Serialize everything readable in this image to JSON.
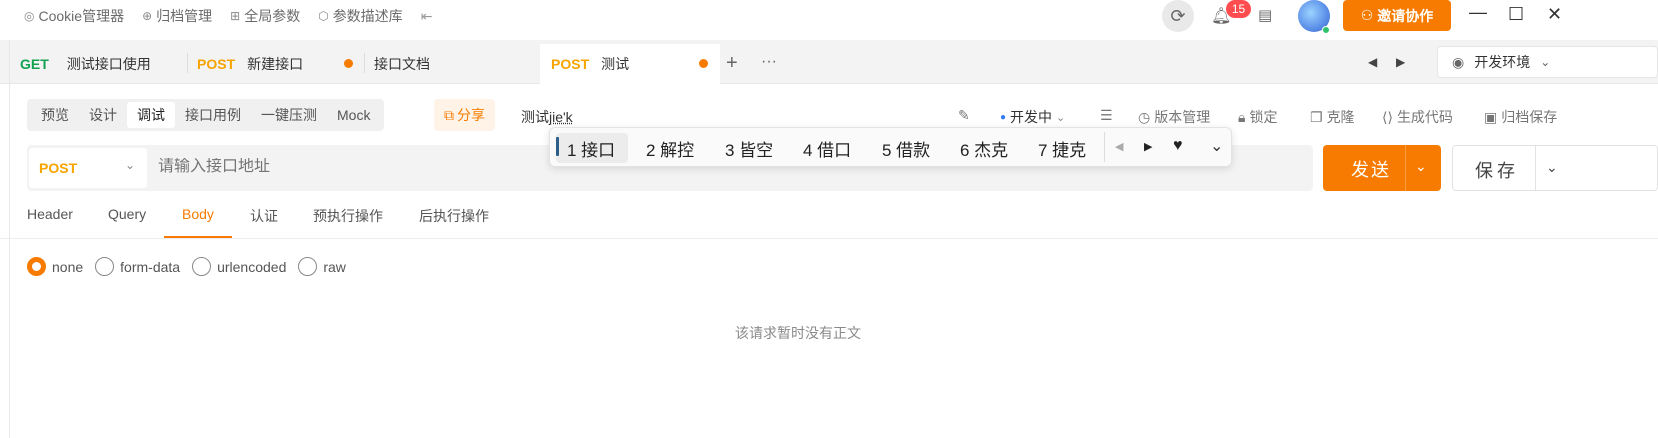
{
  "top_nav": [
    {
      "icon": "cookie-icon",
      "glyph": "◎",
      "label": "Cookie管理器"
    },
    {
      "icon": "archive-icon",
      "glyph": "⊕",
      "label": "归档管理"
    },
    {
      "icon": "params-icon",
      "glyph": "⊞",
      "label": "全局参数"
    },
    {
      "icon": "cube-icon",
      "glyph": "⬡",
      "label": "参数描述库"
    }
  ],
  "notifications": {
    "count": "15"
  },
  "invite_label": "邀请协作",
  "tabs": [
    {
      "method": "GET",
      "name": "测试接口使用"
    },
    {
      "method": "POST",
      "name": "新建接口",
      "unsaved": true
    },
    {
      "method": "",
      "name": "接口文档"
    },
    {
      "method": "POST",
      "name": "测试",
      "unsaved": true,
      "active": true
    }
  ],
  "environment": "开发环境",
  "modes": [
    "预览",
    "设计",
    "调试",
    "接口用例",
    "一键压测",
    "Mock"
  ],
  "active_mode": "调试",
  "share_label": "分享",
  "request_name": {
    "prefix": "测试",
    "composing": "jie'k"
  },
  "status": "开发中",
  "right_tools": [
    "版本管理",
    "锁定",
    "克隆",
    "生成代码",
    "归档保存"
  ],
  "method_select": "POST",
  "url_placeholder": "请输入接口地址",
  "send_label": "发送",
  "save_label": "保存",
  "ime_candidates": [
    "1 接口",
    "2 解控",
    "3 皆空",
    "4 借口",
    "5 借款",
    "6 杰克",
    "7 捷克"
  ],
  "body_tabs": [
    "Header",
    "Query",
    "Body",
    "认证",
    "预执行操作",
    "后执行操作"
  ],
  "active_body_tab": "Body",
  "body_types": [
    "none",
    "form-data",
    "urlencoded",
    "raw"
  ],
  "selected_body_type": "none",
  "empty_message": "该请求暂时没有正文",
  "colors": {
    "accent": "#f77b00",
    "get": "#12a150",
    "post": "#f7a400",
    "badge": "#ff4d4f"
  }
}
